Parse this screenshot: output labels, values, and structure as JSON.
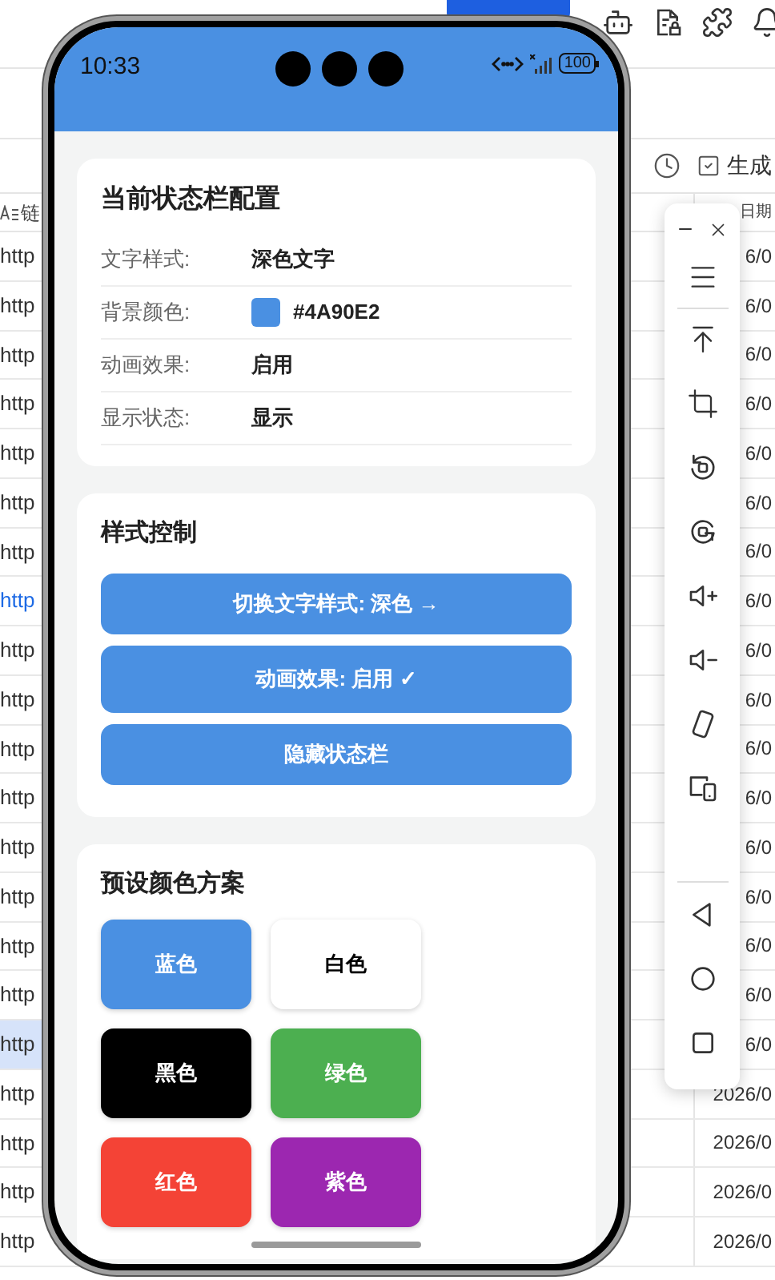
{
  "sheet": {
    "toolbar_label": "生成",
    "header": {
      "column_1": "链",
      "column_2": "日期"
    },
    "rows": [
      {
        "link": "http",
        "kind": "text",
        "selected": false,
        "date": "6/0"
      },
      {
        "link": "http",
        "kind": "text",
        "selected": false,
        "date": "6/0"
      },
      {
        "link": "http",
        "kind": "text",
        "selected": false,
        "date": "6/0"
      },
      {
        "link": "http",
        "kind": "text",
        "selected": false,
        "date": "6/0"
      },
      {
        "link": "http",
        "kind": "text",
        "selected": false,
        "date": "6/0"
      },
      {
        "link": "http",
        "kind": "text",
        "selected": false,
        "date": "6/0"
      },
      {
        "link": "http",
        "kind": "text",
        "selected": false,
        "date": "6/0"
      },
      {
        "link": "http",
        "kind": "link",
        "selected": false,
        "date": "6/0"
      },
      {
        "link": "http",
        "kind": "text",
        "selected": false,
        "date": "6/0"
      },
      {
        "link": "http",
        "kind": "text",
        "selected": false,
        "date": "6/0"
      },
      {
        "link": "http",
        "kind": "text",
        "selected": false,
        "date": "6/0"
      },
      {
        "link": "http",
        "kind": "text",
        "selected": false,
        "date": "6/0"
      },
      {
        "link": "http",
        "kind": "text",
        "selected": false,
        "date": "6/0"
      },
      {
        "link": "http",
        "kind": "text",
        "selected": false,
        "date": "6/0"
      },
      {
        "link": "http",
        "kind": "text",
        "selected": false,
        "date": "6/0"
      },
      {
        "link": "http",
        "kind": "text",
        "selected": false,
        "date": "6/0"
      },
      {
        "link": "http",
        "kind": "text",
        "selected": true,
        "date": "6/0"
      },
      {
        "link": "http",
        "kind": "text",
        "selected": false,
        "date": "2026/0"
      },
      {
        "link": "http",
        "kind": "text",
        "selected": false,
        "date": "2026/0"
      },
      {
        "link": "http",
        "kind": "text",
        "selected": false,
        "date": "2026/0"
      },
      {
        "link": "http",
        "kind": "text",
        "selected": false,
        "date": "2026/0"
      }
    ]
  },
  "phone": {
    "status_bar": {
      "time": "10:33",
      "battery": "100",
      "color": "#4a90e2"
    },
    "config_card": {
      "title": "当前状态栏配置",
      "rows": [
        {
          "label": "文字样式:",
          "kind": "text",
          "value": "深色文字"
        },
        {
          "label": "背景颜色:",
          "kind": "color",
          "value": "#4A90E2",
          "color": "#4a90e2"
        },
        {
          "label": "动画效果:",
          "kind": "text",
          "value": "启用"
        },
        {
          "label": "显示状态:",
          "kind": "text",
          "value": "显示"
        }
      ]
    },
    "control_card": {
      "title": "样式控制",
      "buttons": [
        "切换文字样式: 深色 →",
        "动画效果: 启用 ✓",
        "隐藏状态栏"
      ]
    },
    "preset_card": {
      "title": "预设颜色方案",
      "presets": [
        {
          "label": "蓝色",
          "color": "#4a90e2"
        },
        {
          "label": "白色",
          "color": "#ffffff"
        },
        {
          "label": "黑色",
          "color": "#000000"
        },
        {
          "label": "绿色",
          "color": "#4caf50"
        },
        {
          "label": "红色",
          "color": "#f44336"
        },
        {
          "label": "紫色",
          "color": "#9c27b0"
        }
      ]
    }
  }
}
